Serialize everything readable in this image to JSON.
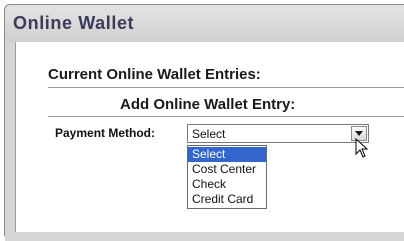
{
  "window": {
    "title": "Online Wallet"
  },
  "main": {
    "current_heading": "Current Online Wallet Entries:",
    "add_heading": "Add Online Wallet Entry:",
    "payment_label": "Payment Method:",
    "select": {
      "value": "Select",
      "options": [
        "Select",
        "Cost Center",
        "Check",
        "Credit Card"
      ],
      "highlighted_index": 0
    }
  },
  "colors": {
    "highlight": "#3366cc",
    "title_text": "#3b3b5a",
    "chrome": "#d6d6d6"
  },
  "icons": [
    "chevron-down-icon",
    "mouse-pointer-icon"
  ]
}
